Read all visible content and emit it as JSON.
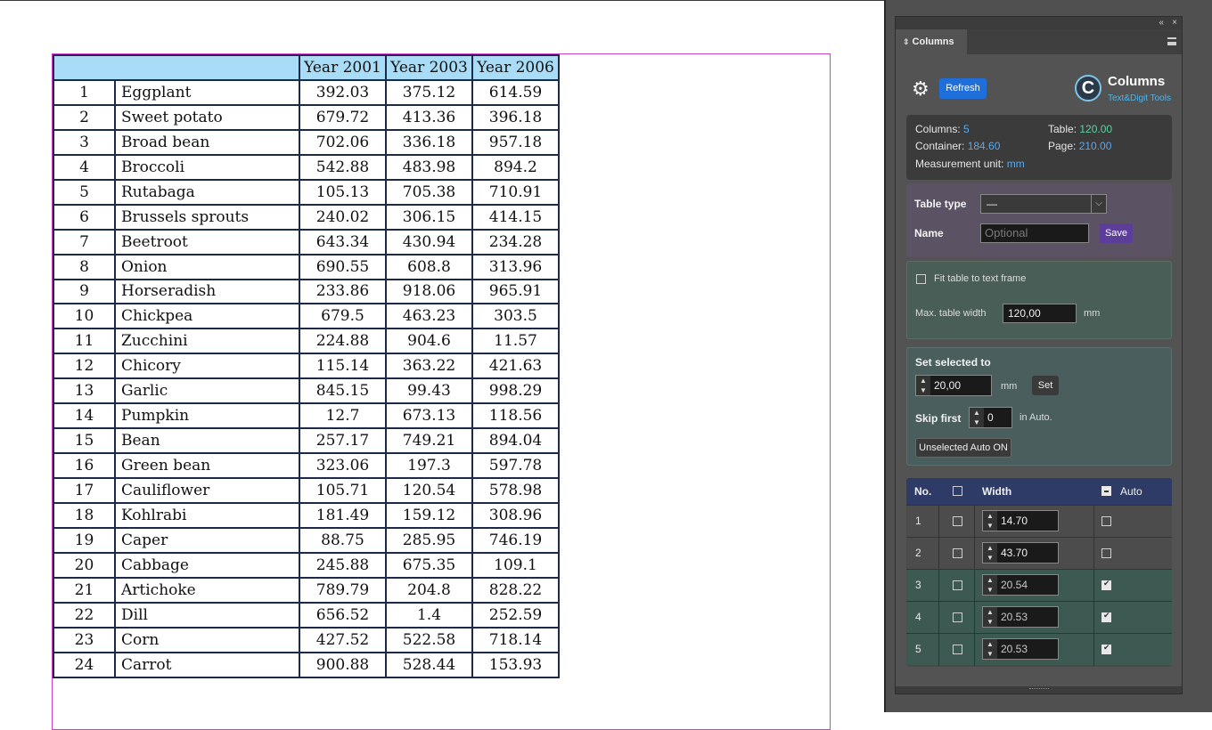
{
  "document": {
    "table": {
      "headers": [
        "",
        "Year 2001",
        "Year 2003",
        "Year 2006"
      ],
      "rows": [
        [
          "1",
          "Eggplant",
          "392.03",
          "375.12",
          "614.59"
        ],
        [
          "2",
          "Sweet potato",
          "679.72",
          "413.36",
          "396.18"
        ],
        [
          "3",
          "Broad bean",
          "702.06",
          "336.18",
          "957.18"
        ],
        [
          "4",
          "Broccoli",
          "542.88",
          "483.98",
          "894.2"
        ],
        [
          "5",
          "Rutabaga",
          "105.13",
          "705.38",
          "710.91"
        ],
        [
          "6",
          "Brussels sprouts",
          "240.02",
          "306.15",
          "414.15"
        ],
        [
          "7",
          "Beetroot",
          "643.34",
          "430.94",
          "234.28"
        ],
        [
          "8",
          "Onion",
          "690.55",
          "608.8",
          "313.96"
        ],
        [
          "9",
          "Horseradish",
          "233.86",
          "918.06",
          "965.91"
        ],
        [
          "10",
          "Chickpea",
          "679.5",
          "463.23",
          "303.5"
        ],
        [
          "11",
          "Zucchini",
          "224.88",
          "904.6",
          "11.57"
        ],
        [
          "12",
          "Chicory",
          "115.14",
          "363.22",
          "421.63"
        ],
        [
          "13",
          "Garlic",
          "845.15",
          "99.43",
          "998.29"
        ],
        [
          "14",
          "Pumpkin",
          "12.7",
          "673.13",
          "118.56"
        ],
        [
          "15",
          "Bean",
          "257.17",
          "749.21",
          "894.04"
        ],
        [
          "16",
          "Green bean",
          "323.06",
          "197.3",
          "597.78"
        ],
        [
          "17",
          "Cauliflower",
          "105.71",
          "120.54",
          "578.98"
        ],
        [
          "18",
          "Kohlrabi",
          "181.49",
          "159.12",
          "308.96"
        ],
        [
          "19",
          "Caper",
          "88.75",
          "285.95",
          "746.19"
        ],
        [
          "20",
          "Cabbage",
          "245.88",
          "675.35",
          "109.1"
        ],
        [
          "21",
          "Artichoke",
          "789.79",
          "204.8",
          "828.22"
        ],
        [
          "22",
          "Dill",
          "656.52",
          "1.4",
          "252.59"
        ],
        [
          "23",
          "Corn",
          "427.52",
          "522.58",
          "718.14"
        ],
        [
          "24",
          "Carrot",
          "900.88",
          "528.44",
          "153.93"
        ]
      ]
    }
  },
  "panel": {
    "topbar": {
      "collapse_glyph": "«",
      "close_glyph": "×"
    },
    "tab": {
      "label": "Columns",
      "arrow_glyph": "⇕"
    },
    "menu_icon": "menu-icon",
    "header": {
      "gear_icon": "gear-icon",
      "refresh_label": "Refresh",
      "logo_letter": "C",
      "app_name": "Columns",
      "app_subtitle": "Text&Digit Tools"
    },
    "info": {
      "columns_label": "Columns: ",
      "columns_value": "5",
      "table_label": "Table: ",
      "table_value": "120.00",
      "container_label": "Container: ",
      "container_value": "184.60",
      "page_label": "Page: ",
      "page_value": "210.00",
      "unit_label": "Measurement unit: ",
      "unit_value": "mm"
    },
    "type": {
      "table_type_label": "Table type",
      "table_type_value": "—",
      "name_label": "Name",
      "name_placeholder": "Optional",
      "save_label": "Save"
    },
    "fit": {
      "fit_label": "Fit table to text frame",
      "fit_checked": false,
      "max_width_label": "Max. table width",
      "max_width_value": "120,00",
      "max_width_unit": "mm"
    },
    "set": {
      "title": "Set selected to",
      "value": "20,00",
      "unit": "mm",
      "set_label": "Set",
      "skip_label": "Skip first",
      "skip_value": "0",
      "skip_suffix": "in Auto.",
      "unselected_auto_label": "Unselected Auto ON"
    },
    "columns_table": {
      "headers": {
        "no": "No.",
        "width": "Width",
        "auto": "Auto"
      },
      "rows": [
        {
          "no": "1",
          "width": "14.70",
          "auto": false,
          "selected": false
        },
        {
          "no": "2",
          "width": "43.70",
          "auto": false,
          "selected": false
        },
        {
          "no": "3",
          "width": "20.54",
          "auto": true,
          "selected": false
        },
        {
          "no": "4",
          "width": "20.53",
          "auto": true,
          "selected": false
        },
        {
          "no": "5",
          "width": "20.53",
          "auto": true,
          "selected": false
        }
      ]
    },
    "colors": {
      "refresh": "#1f6fdb",
      "save": "#5c3d99",
      "value_blue": "#5aa8ee",
      "value_green": "#60d0a0",
      "col_header": "#2e3b66"
    }
  }
}
